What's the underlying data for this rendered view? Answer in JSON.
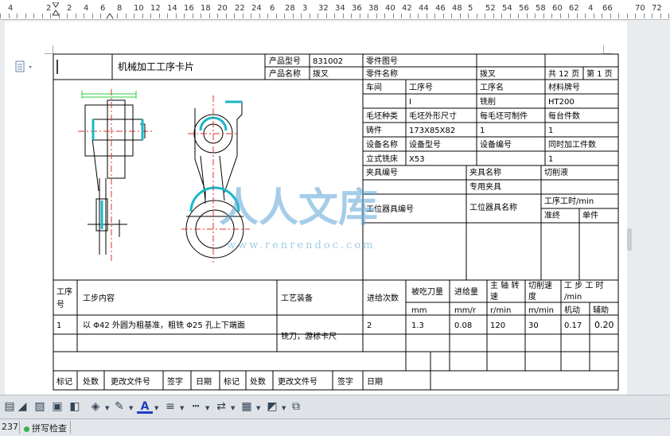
{
  "ruler": {
    "numbers": [
      {
        "t": "4"
      },
      {
        "t": "2"
      },
      {
        "t": "2"
      },
      {
        "t": "4"
      },
      {
        "t": "6"
      },
      {
        "t": "8"
      },
      {
        "t": "10"
      },
      {
        "t": "12"
      },
      {
        "t": "14"
      },
      {
        "t": "16"
      },
      {
        "t": "18"
      },
      {
        "t": "20"
      },
      {
        "t": "22"
      },
      {
        "t": "24"
      },
      {
        "t": "6"
      },
      {
        "t": "28"
      },
      {
        "t": "3"
      },
      {
        "t": "32"
      },
      {
        "t": "34"
      },
      {
        "t": "36"
      },
      {
        "t": "38"
      },
      {
        "t": "40"
      },
      {
        "t": "42"
      },
      {
        "t": "44"
      },
      {
        "t": "46"
      },
      {
        "t": "48"
      },
      {
        "t": "5"
      },
      {
        "t": "52"
      },
      {
        "t": "54"
      },
      {
        "t": "56"
      },
      {
        "t": "58"
      },
      {
        "t": "60"
      },
      {
        "t": "62"
      },
      {
        "t": "4"
      },
      {
        "t": "66"
      },
      {
        "t": "70"
      },
      {
        "t": "72"
      }
    ]
  },
  "card": {
    "title": "机械加工工序卡片",
    "header": {
      "product_model_label": "产品型号",
      "product_model": "831002",
      "part_drawing_no_label": "零件图号",
      "product_name_label": "产品名称",
      "product_name": "拨叉",
      "part_name_label": "零件名称",
      "part_name": "拨叉",
      "total_pages": "共 12 页",
      "page_no": "第 1 页"
    },
    "info": {
      "workshop_label": "车间",
      "process_no_label": "工序号",
      "process_name_label": "工序名",
      "material_label": "材料牌号",
      "process_no": "I",
      "process_name": "铣削",
      "material": "HT200",
      "blank_type_label": "毛坯种类",
      "blank_size_label": "毛坯外形尺寸",
      "per_blank_label": "每毛坯可制件",
      "per_machine_label": "每台件数",
      "blank_type": "铸件",
      "blank_size": "173X85X82",
      "per_blank": "1",
      "per_machine": "1",
      "equip_name_label": "设备名称",
      "equip_model_label": "设备型号",
      "equip_no_label": "设备编号",
      "simul_label": "同时加工件数",
      "equip_name": "立式铣床",
      "equip_model": "X53",
      "simul": "1",
      "fixture_no_label": "夹具编号",
      "fixture_name_label": "夹具名称",
      "coolant_label": "切削液",
      "fixture_name": "专用夹具",
      "station_tool_no_label": "工位器具编号",
      "station_tool_name_label": "工位器具名称",
      "process_time_label": "工序工时/min",
      "standard_label": "准终",
      "unit_label": "单件"
    },
    "steps_header": {
      "step_no": [
        "工序",
        "号"
      ],
      "content": "工步内容",
      "equipment": "工艺装备",
      "feed_times": "进给次数",
      "depth": "被吃刀量",
      "feed": "进给量",
      "spindle": [
        "主 轴 转",
        "速"
      ],
      "speed": [
        "切削速",
        "度"
      ],
      "step_time": [
        "工 步 工 时",
        "/min"
      ],
      "u_depth": "mm",
      "u_feed": "mm/r",
      "u_spindle": "r/min",
      "u_speed": "m/min",
      "machine_time": "机动",
      "aux_time": "辅助"
    },
    "steps": [
      {
        "no": "1",
        "content": "以 Φ42 外圆为粗基准，粗铣 Φ25 孔上下端面",
        "equipment": "铣刀，游标卡尺",
        "feed_times": "2",
        "depth": "1.3",
        "feed": "0.08",
        "spindle": "120",
        "speed": "30",
        "machine": "0.17",
        "aux": "0.20"
      }
    ],
    "footer": [
      "标记",
      "处数",
      "更改文件号",
      "签字",
      "日期",
      "标记",
      "处数",
      "更改文件号",
      "签字",
      "日期"
    ]
  },
  "watermark": {
    "text": "人人文库",
    "url": "www.renrendoc.com"
  },
  "toolbar": {
    "icons": [
      "text-box-icon",
      "wordart-icon",
      "picture-icon",
      "insert-image-icon",
      "shape-icon",
      "fill-color-icon",
      "line-color-icon",
      "font-color-icon",
      "line-style-icon",
      "dash-style-icon",
      "arrow-style-icon",
      "shadow-icon",
      "3d-icon",
      "arrange-icon"
    ],
    "font_color_glyph": "A"
  },
  "status": {
    "count": "237",
    "spell_check": "拼写检查"
  },
  "colors": {
    "drawing_green": "#2ecc40",
    "drawing_cyan": "#18b8c8",
    "drawing_red": "#e0302a",
    "accent_font": "#1f3fbf"
  }
}
